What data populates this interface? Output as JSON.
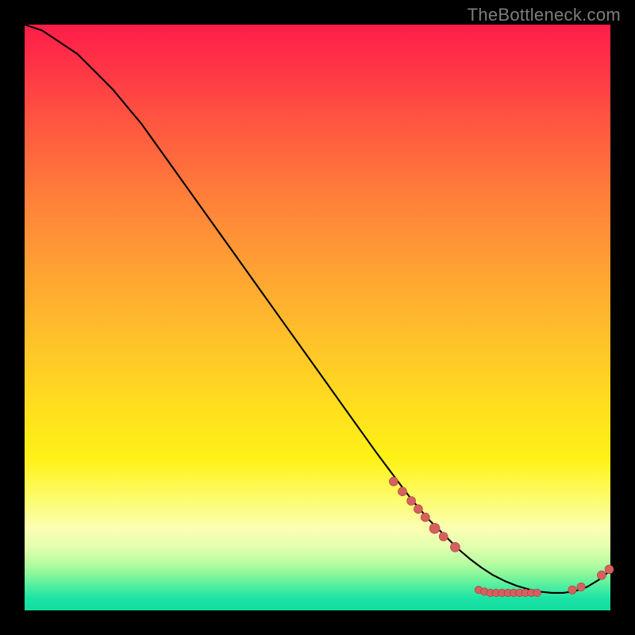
{
  "watermark": "TheBottleneck.com",
  "colors": {
    "dot_fill": "#d66060",
    "dot_stroke": "#a83c3c",
    "curve": "#000000"
  },
  "chart_data": {
    "type": "line",
    "title": "",
    "xlabel": "",
    "ylabel": "",
    "xlim": [
      0,
      100
    ],
    "ylim": [
      0,
      100
    ],
    "curve": {
      "x": [
        0,
        3,
        6,
        9,
        12,
        15,
        20,
        25,
        30,
        35,
        40,
        45,
        50,
        55,
        60,
        63,
        66,
        69,
        72,
        74,
        76,
        78,
        80,
        82,
        84,
        86,
        88,
        90,
        92,
        94,
        96,
        98,
        100
      ],
      "y": [
        100,
        99,
        97,
        95,
        92,
        89,
        83,
        76,
        69,
        62,
        55,
        48,
        41,
        34,
        27,
        23,
        19,
        15.5,
        12.5,
        10.5,
        8.8,
        7.3,
        6.0,
        5.0,
        4.2,
        3.6,
        3.2,
        3.0,
        3.0,
        3.3,
        4.0,
        5.2,
        6.8
      ]
    },
    "points": [
      {
        "x": 63.0,
        "y": 22.0,
        "r": 5.5
      },
      {
        "x": 64.5,
        "y": 20.3,
        "r": 5.5
      },
      {
        "x": 66.0,
        "y": 18.7,
        "r": 5.5
      },
      {
        "x": 67.2,
        "y": 17.3,
        "r": 5.5
      },
      {
        "x": 68.4,
        "y": 15.9,
        "r": 5.5
      },
      {
        "x": 70.0,
        "y": 14.0,
        "r": 6.5
      },
      {
        "x": 71.5,
        "y": 12.6,
        "r": 5.5
      },
      {
        "x": 73.5,
        "y": 10.8,
        "r": 6.0
      },
      {
        "x": 77.5,
        "y": 3.5,
        "r": 4.8
      },
      {
        "x": 78.5,
        "y": 3.2,
        "r": 4.8
      },
      {
        "x": 79.5,
        "y": 3.0,
        "r": 4.8
      },
      {
        "x": 80.5,
        "y": 3.0,
        "r": 4.8
      },
      {
        "x": 81.5,
        "y": 3.0,
        "r": 4.8
      },
      {
        "x": 82.5,
        "y": 3.0,
        "r": 4.8
      },
      {
        "x": 83.5,
        "y": 3.0,
        "r": 4.8
      },
      {
        "x": 84.5,
        "y": 3.0,
        "r": 4.8
      },
      {
        "x": 85.5,
        "y": 3.0,
        "r": 4.8
      },
      {
        "x": 86.5,
        "y": 3.0,
        "r": 4.8
      },
      {
        "x": 87.5,
        "y": 3.0,
        "r": 4.8
      },
      {
        "x": 93.5,
        "y": 3.5,
        "r": 5.2
      },
      {
        "x": 95.0,
        "y": 4.0,
        "r": 5.2
      },
      {
        "x": 98.5,
        "y": 6.0,
        "r": 5.5
      },
      {
        "x": 99.8,
        "y": 7.0,
        "r": 5.5
      }
    ]
  }
}
